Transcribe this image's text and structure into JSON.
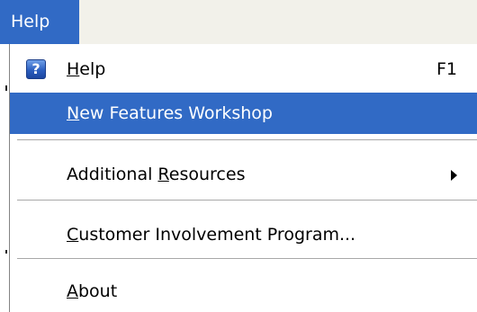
{
  "menubar": {
    "active_menu": "Help"
  },
  "menu": {
    "items": [
      {
        "label_pre": "",
        "mnemonic": "H",
        "label_post": "elp",
        "shortcut": "F1",
        "icon": "help-question-icon"
      },
      {
        "label_pre": "",
        "mnemonic": "N",
        "label_post": "ew Features Workshop",
        "shortcut": ""
      },
      {
        "label_pre": "Additional ",
        "mnemonic": "R",
        "label_post": "esources",
        "shortcut": ""
      },
      {
        "label_pre": "",
        "mnemonic": "C",
        "label_post": "ustomer Involvement Program...",
        "shortcut": ""
      },
      {
        "label_pre": "",
        "mnemonic": "A",
        "label_post": "bout",
        "shortcut": ""
      }
    ]
  },
  "colors": {
    "highlight": "#316ac5",
    "menubar_bg": "#ece9d8",
    "menu_bg": "#ffffff"
  }
}
